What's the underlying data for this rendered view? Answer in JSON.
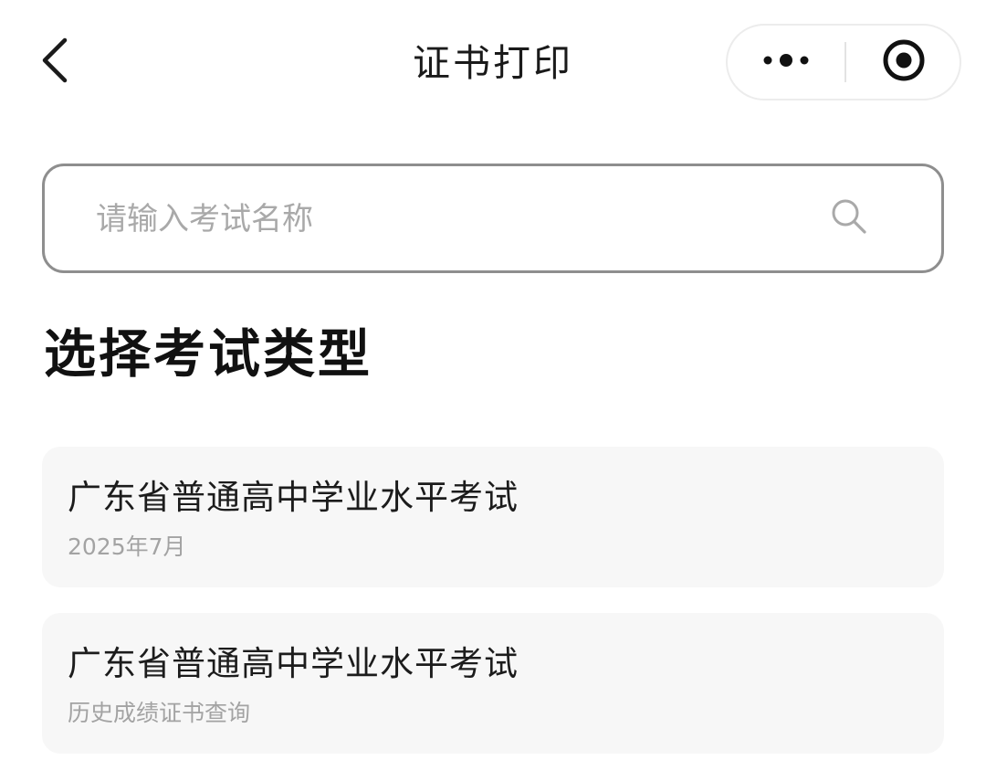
{
  "nav": {
    "title": "证书打印",
    "back_icon": "chevron-left-icon",
    "more_icon": "more-dots-icon",
    "close_icon": "target-circle-icon"
  },
  "search": {
    "placeholder": "请输入考试名称",
    "value": "",
    "icon": "search-icon"
  },
  "section": {
    "heading": "选择考试类型"
  },
  "exams": [
    {
      "title": "广东省普通高中学业水平考试",
      "subtitle": "2025年7月"
    },
    {
      "title": "广东省普通高中学业水平考试",
      "subtitle": "历史成绩证书查询"
    }
  ],
  "colors": {
    "background": "#ffffff",
    "card_background": "#f7f7f7",
    "border": "#8e8e8e",
    "text_primary": "#1a1a1a",
    "text_secondary": "#a3a3a3"
  }
}
